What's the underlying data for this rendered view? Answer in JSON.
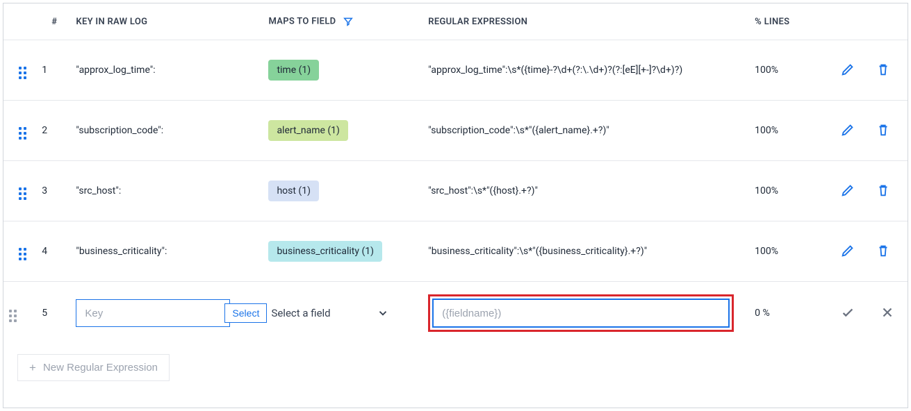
{
  "headers": {
    "index": "#",
    "key": "KEY IN RAW LOG",
    "field": "MAPS TO FIELD",
    "regex": "REGULAR EXPRESSION",
    "lines": "% LINES"
  },
  "rows": [
    {
      "index": "1",
      "key": "\"approx_log_time\":",
      "field_label": "time (1)",
      "field_color": "green",
      "regex": "\"approx_log_time\":\\s*({time}-?\\d+(?:\\.\\d+)?(?:[eE][+-]?\\d+)?)",
      "lines": "100%"
    },
    {
      "index": "2",
      "key": "\"subscription_code\":",
      "field_label": "alert_name (1)",
      "field_color": "lime",
      "regex": "\"subscription_code\":\\s*\"({alert_name}.+?)\"",
      "lines": "100%"
    },
    {
      "index": "3",
      "key": "\"src_host\":",
      "field_label": "host (1)",
      "field_color": "blue",
      "regex": "\"src_host\":\\s*\"({host}.+?)\"",
      "lines": "100%"
    },
    {
      "index": "4",
      "key": "\"business_criticality\":",
      "field_label": "business_criticality (1)",
      "field_color": "teal",
      "regex": "\"business_criticality\":\\s*\"({business_criticality}.+?)\"",
      "lines": "100%"
    }
  ],
  "editing": {
    "index": "5",
    "key_placeholder": "Key",
    "select_label": "Select",
    "field_placeholder": "Select a field",
    "regex_placeholder": "({fieldname})",
    "lines": "0 %"
  },
  "footer": {
    "new_label": "New Regular Expression"
  }
}
